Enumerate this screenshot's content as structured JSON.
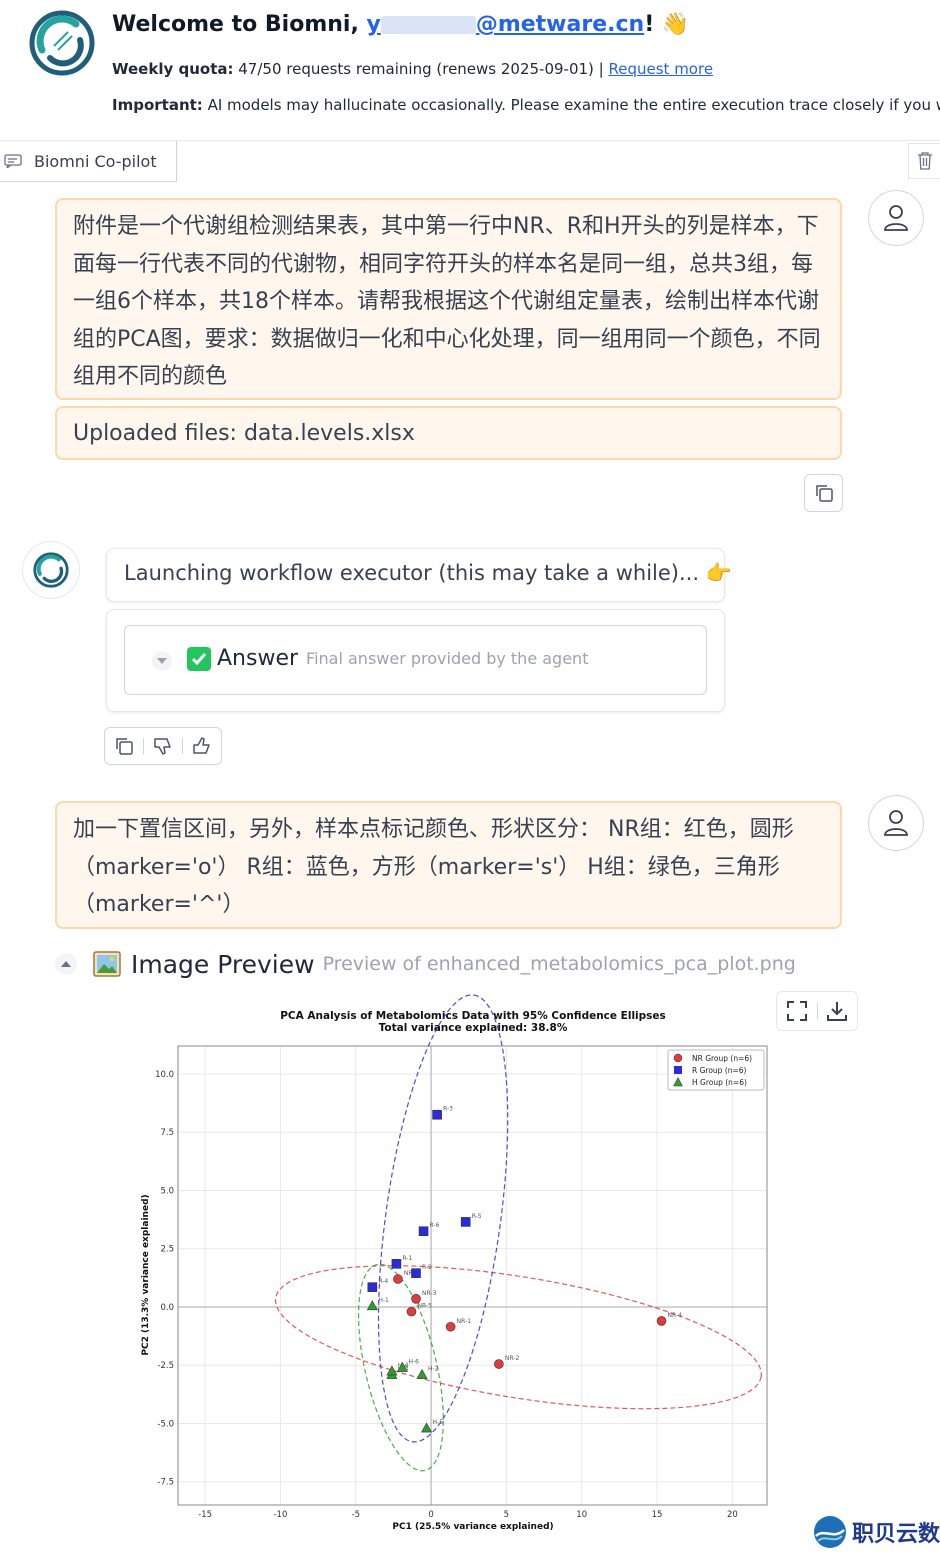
{
  "header": {
    "welcome_prefix": "Welcome to Biomni, ",
    "email_start": "y",
    "email_end": "@metware.cn",
    "welcome_suffix": "! 👋",
    "quota_label": "Weekly quota:",
    "quota_text": " 47/50 requests remaining (renews 2025-09-01) | ",
    "request_more": "Request more",
    "important_label": "Important:",
    "important_text": " AI models may hallucinate occasionally. Please examine the entire execution trace closely if you w"
  },
  "tabs": {
    "active": "Biomni Co-pilot"
  },
  "messages": {
    "user1": "附件是一个代谢组检测结果表，其中第一行中NR、R和H开头的列是样本，下面每一行代表不同的代谢物，相同字符开头的样本名是同一组，总共3组，每一组6个样本，共18个样本。请帮我根据这个代谢组定量表，绘制出样本代谢组的PCA图，要求：数据做归一化和中心化处理，同一组用同一个颜色，不同组用不同的颜色",
    "uploaded": "Uploaded files: data.levels.xlsx",
    "bot_launch": "Launching workflow executor (this may take a while)... 👉",
    "answer_title": "Answer",
    "answer_sub": "Final answer provided by the agent",
    "user2": "加一下置信区间，另外，样本点标记颜色、形状区分： NR组：红色，圆形（marker='o'） R组：蓝色，方形（marker='s'） H组：绿色，三角形（marker='^'）"
  },
  "preview": {
    "title": "Image Preview",
    "subtitle": "Preview of enhanced_metabolomics_pca_plot.png"
  },
  "watermark": "职贝云数",
  "colors": {
    "accent": "#2563eb",
    "bubble_bg": "#fff7ed",
    "bubble_border": "#fed7aa",
    "check": "#22c55e"
  },
  "chart_data": {
    "type": "scatter",
    "title": "PCA Analysis of Metabolomics Data with 95% Confidence Ellipses",
    "subtitle": "Total variance explained: 38.8%",
    "xlabel": "PC1 (25.5% variance explained)",
    "ylabel": "PC2 (13.3% variance explained)",
    "xlim": [
      -16.8,
      22.3
    ],
    "ylim": [
      -8.5,
      11.2
    ],
    "xticks": [
      -15,
      -10,
      -5,
      0,
      5,
      10,
      15,
      20
    ],
    "yticks": [
      -7.5,
      -5.0,
      -2.5,
      0.0,
      2.5,
      5.0,
      7.5,
      10.0
    ],
    "xtick_labels": [
      "-15",
      "-10",
      "-5",
      "0",
      "5",
      "10",
      "15",
      "20"
    ],
    "ytick_labels": [
      "-7.5",
      "-5.0",
      "-2.5",
      "0.0",
      "2.5",
      "5.0",
      "7.5",
      "10.0"
    ],
    "grid": true,
    "legend_position": "top-right",
    "series": [
      {
        "name": "NR Group (n=6)",
        "color": "#e03c3c",
        "marker": "circle",
        "points": [
          {
            "label": "NR-1",
            "x": 1.3,
            "y": -0.85
          },
          {
            "label": "NR-2",
            "x": 4.5,
            "y": -2.45
          },
          {
            "label": "NR-3",
            "x": -1.0,
            "y": 0.35
          },
          {
            "label": "NR-4",
            "x": 15.3,
            "y": -0.6
          },
          {
            "label": "NR-5",
            "x": -1.3,
            "y": -0.2
          },
          {
            "label": "NR-6",
            "x": -2.2,
            "y": 1.2
          }
        ],
        "ellipse": {
          "cx": 5.8,
          "cy": -1.3,
          "rx": 16.2,
          "ry": 2.6,
          "angle_deg": -6
        }
      },
      {
        "name": "R Group (n=6)",
        "color": "#2b2bd8",
        "marker": "square",
        "points": [
          {
            "label": "R-1",
            "x": -2.3,
            "y": 1.85
          },
          {
            "label": "R-2",
            "x": -1.0,
            "y": 1.45
          },
          {
            "label": "R-3",
            "x": 0.4,
            "y": 8.25
          },
          {
            "label": "R-4",
            "x": -3.9,
            "y": 0.85
          },
          {
            "label": "R-5",
            "x": 2.3,
            "y": 3.65
          },
          {
            "label": "R-6",
            "x": -0.5,
            "y": 3.25
          }
        ],
        "ellipse": {
          "cx": 0.8,
          "cy": 3.8,
          "rx": 9.8,
          "ry": 3.7,
          "angle_deg": 78
        }
      },
      {
        "name": "H Group (n=6)",
        "color": "#2ca02c",
        "marker": "triangle",
        "points": [
          {
            "label": "H-1",
            "x": -3.9,
            "y": 0.05
          },
          {
            "label": "H-2",
            "x": -0.6,
            "y": -2.9
          },
          {
            "label": "H-3",
            "x": -2.6,
            "y": -2.9
          },
          {
            "label": "H-4",
            "x": -2.6,
            "y": -2.75
          },
          {
            "label": "H-5",
            "x": -0.3,
            "y": -5.2
          },
          {
            "label": "H-6",
            "x": -1.9,
            "y": -2.6
          }
        ],
        "ellipse": {
          "cx": -2.0,
          "cy": -2.6,
          "rx": 4.7,
          "ry": 2.2,
          "angle_deg": -70
        }
      }
    ]
  }
}
